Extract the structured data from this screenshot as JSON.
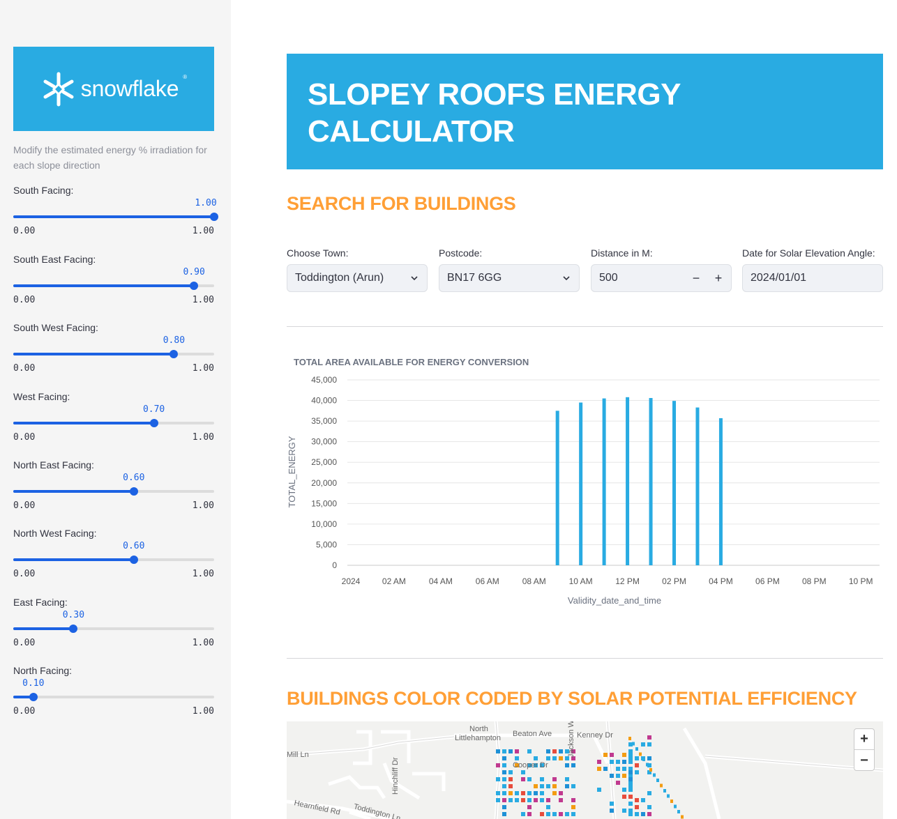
{
  "logo": {
    "text": "snowflake",
    "reg": "®"
  },
  "sidebar": {
    "caption": "Modify the estimated energy % irradiation for each slope direction",
    "sliders": [
      {
        "label": "South Facing:",
        "value": 1.0,
        "value_text": "1.00",
        "min": "0.00",
        "max": "1.00"
      },
      {
        "label": "South East Facing:",
        "value": 0.9,
        "value_text": "0.90",
        "min": "0.00",
        "max": "1.00"
      },
      {
        "label": "South West Facing:",
        "value": 0.8,
        "value_text": "0.80",
        "min": "0.00",
        "max": "1.00"
      },
      {
        "label": "West Facing:",
        "value": 0.7,
        "value_text": "0.70",
        "min": "0.00",
        "max": "1.00"
      },
      {
        "label": "North East Facing:",
        "value": 0.6,
        "value_text": "0.60",
        "min": "0.00",
        "max": "1.00"
      },
      {
        "label": "North West Facing:",
        "value": 0.6,
        "value_text": "0.60",
        "min": "0.00",
        "max": "1.00"
      },
      {
        "label": "East Facing:",
        "value": 0.3,
        "value_text": "0.30",
        "min": "0.00",
        "max": "1.00"
      },
      {
        "label": "North Facing:",
        "value": 0.1,
        "value_text": "0.10",
        "min": "0.00",
        "max": "1.00"
      }
    ]
  },
  "header": {
    "title": "SLOPEY ROOFS ENERGY CALCULATOR"
  },
  "search": {
    "heading": "SEARCH FOR BUILDINGS",
    "town_label": "Choose Town:",
    "town_value": "Toddington (Arun)",
    "postcode_label": "Postcode:",
    "postcode_value": "BN17 6GG",
    "distance_label": "Distance in M:",
    "distance_value": "500",
    "minus": "−",
    "plus": "+",
    "date_label": "Date for Solar Elevation Angle:",
    "date_value": "2024/01/01"
  },
  "chart_data": {
    "type": "bar",
    "title": "TOTAL AREA AVAILABLE FOR ENERGY CONVERSION",
    "xlabel": "Validity_date_and_time",
    "ylabel": "TOTAL_ENERGY",
    "ylim": [
      0,
      45000
    ],
    "y_ticks": [
      "0",
      "5,000",
      "10,000",
      "15,000",
      "20,000",
      "25,000",
      "30,000",
      "35,000",
      "40,000",
      "45,000"
    ],
    "x_ticks": [
      "2024",
      "02 AM",
      "04 AM",
      "06 AM",
      "08 AM",
      "10 AM",
      "12 PM",
      "02 PM",
      "04 PM",
      "06 PM",
      "08 PM",
      "10 PM"
    ],
    "x_hours_range": [
      0,
      22.8
    ],
    "bar_color": "#29abe2",
    "grid": true,
    "bars": [
      {
        "hour": 9,
        "value": 37500
      },
      {
        "hour": 10,
        "value": 39500
      },
      {
        "hour": 11,
        "value": 40500
      },
      {
        "hour": 12,
        "value": 40800
      },
      {
        "hour": 13,
        "value": 40600
      },
      {
        "hour": 14,
        "value": 39900
      },
      {
        "hour": 15,
        "value": 38300
      },
      {
        "hour": 16,
        "value": 35700
      }
    ]
  },
  "map_section": {
    "heading": "BUILDINGS COLOR CODED BY SOLAR POTENTIAL EFFICIENCY",
    "zoom_in": "+",
    "zoom_out": "−",
    "labels": {
      "north": "North",
      "littlehampton": "Littlehampton",
      "beaton": "Beaton Ave",
      "kenney": "Kenney Dr",
      "mill": "Mill Ln",
      "cooper": "Cooper Dr",
      "hinchliff": "Hinchliff Dr",
      "hearnfield": "Hearnfield Rd",
      "toddington_ln": "Toddington Ln",
      "jackson": "Jackson W"
    }
  }
}
